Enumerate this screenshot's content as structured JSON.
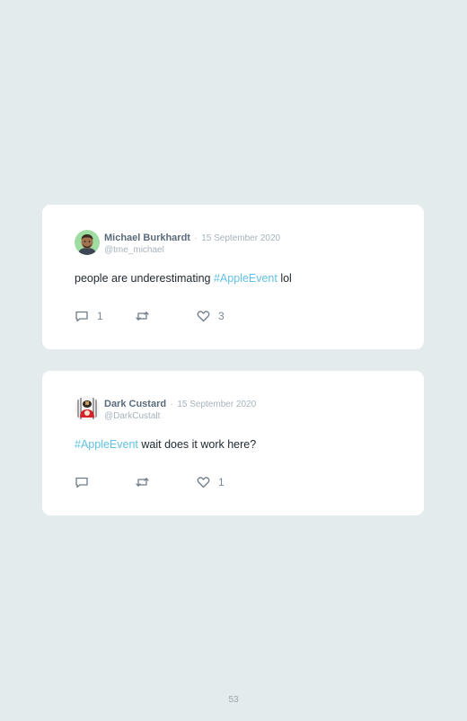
{
  "tweets": [
    {
      "name": "Michael Burkhardt",
      "separator": "·",
      "date": "15 September 2020",
      "handle": "@tme_michael",
      "text_before": "people are underestimating ",
      "hashtag": "#AppleEvent",
      "text_after": " lol",
      "replies": "1",
      "retweets": "",
      "likes": "3"
    },
    {
      "name": "Dark Custard",
      "separator": "·",
      "date": "15 September 2020",
      "handle": "@DarkCustalt",
      "text_before": "",
      "hashtag": "#AppleEvent",
      "text_after": " wait does it work here?",
      "replies": "",
      "retweets": "",
      "likes": "1"
    }
  ],
  "page_number": "53",
  "colors": {
    "background": "#e4ebed",
    "card": "#ffffff",
    "hashtag": "#62c2e3",
    "name": "#5c6b7a",
    "meta": "#a7b2bd"
  },
  "icons": [
    "reply-icon",
    "retweet-icon",
    "like-icon"
  ]
}
